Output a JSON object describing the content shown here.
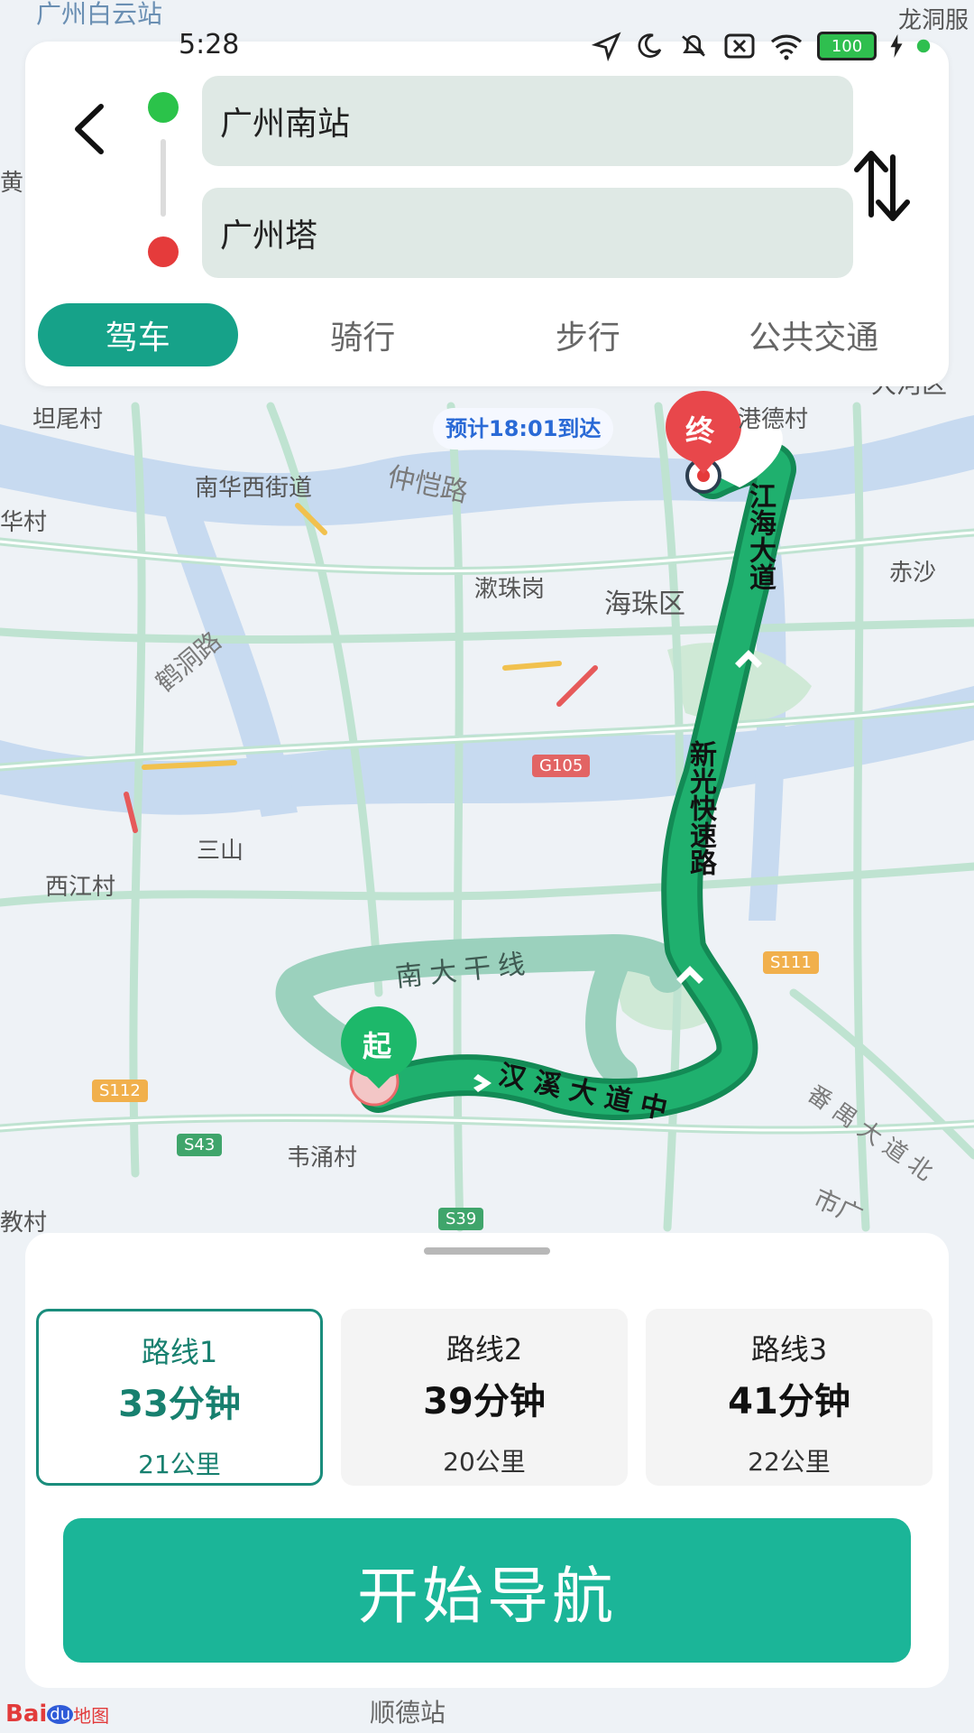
{
  "status_bar": {
    "time": "5:28",
    "battery": "100"
  },
  "search": {
    "origin": "广州南站",
    "destination": "广州塔"
  },
  "modes": [
    {
      "label": "驾车",
      "active": true
    },
    {
      "label": "骑行",
      "active": false
    },
    {
      "label": "步行",
      "active": false
    },
    {
      "label": "公共交通",
      "active": false
    }
  ],
  "map": {
    "eta_banner": "预计18:01到达",
    "end_marker": "终",
    "start_marker": "起",
    "labels": {
      "top1": "广州白云站",
      "top_right": "龙洞服",
      "tanwei": "坦尾村",
      "nanhua": "南华西街道",
      "zhongkai": "仲恺路",
      "huacun": "华村",
      "gangde": "港德村",
      "chisha": "赤沙",
      "sushuan": "漱珠岗",
      "haizhu": "海珠区",
      "hedong": "鹤洞路",
      "sanshan": "三山",
      "xijiang": "西江村",
      "nandagan": "南大干线",
      "weiyong": "韦涌村",
      "jiaocun": "教村",
      "panyu": "番禺大道北",
      "shiguang": "市广",
      "shunde": "顺德站",
      "jianghai": "江海大道",
      "xinguang": "新光快速路",
      "hanxi": "汉溪大道中",
      "g105": "G105",
      "s111": "S111",
      "s112": "S112",
      "s43": "S43",
      "s39": "S39",
      "baidu": "Bai",
      "baidu2": "du",
      "baidu3": "地图",
      "edge_left1": "黄",
      "edge_right": "大河区"
    }
  },
  "routes": [
    {
      "name": "路线1",
      "time": "33分钟",
      "distance": "21公里",
      "active": true
    },
    {
      "name": "路线2",
      "time": "39分钟",
      "distance": "20公里",
      "active": false
    },
    {
      "name": "路线3",
      "time": "41分钟",
      "distance": "22公里",
      "active": false
    }
  ],
  "actions": {
    "start_navigation": "开始导航"
  },
  "colors": {
    "accent": "#16a289",
    "route_green": "#1aa36a",
    "start_dot": "#2bc34a",
    "end_dot": "#e53b3b",
    "button": "#1bb598"
  }
}
